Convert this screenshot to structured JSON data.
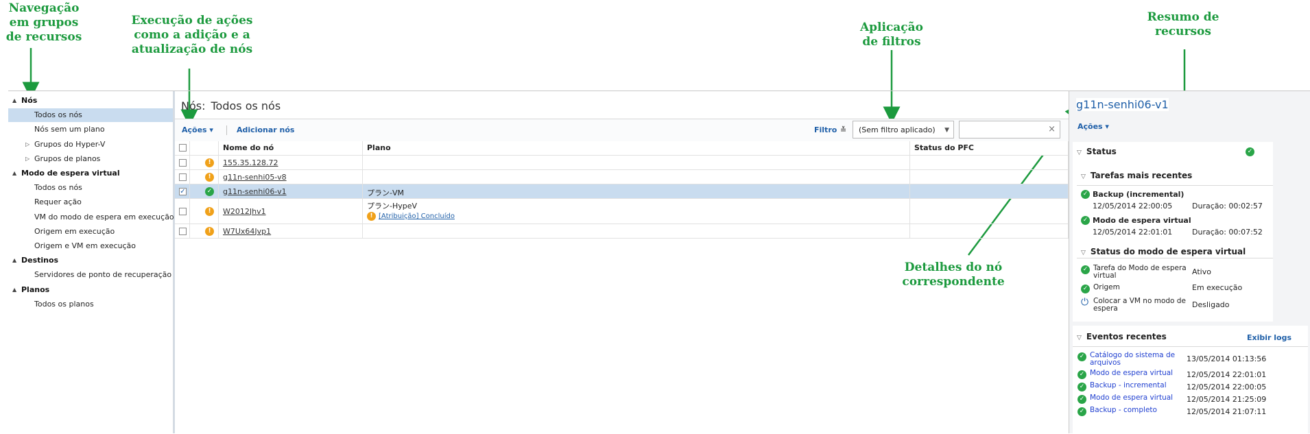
{
  "callouts": {
    "nav": [
      "Navegação",
      "em grupos",
      "de recursos"
    ],
    "actions": [
      "Execução de ações",
      "como a adição e a",
      "atualização de nós"
    ],
    "filters": [
      "Aplicação",
      "de filtros"
    ],
    "summary": [
      "Resumo de",
      "recursos"
    ],
    "details": [
      "Detalhes do nó",
      "correspondente"
    ]
  },
  "tree": [
    {
      "label": "Nós",
      "level": 0,
      "expand": "▲"
    },
    {
      "label": "Todos os nós",
      "level": 1,
      "selected": true
    },
    {
      "label": "Nós sem um plano",
      "level": 1
    },
    {
      "label": "Grupos do Hyper-V",
      "level": 1,
      "expand": "▷"
    },
    {
      "label": "Grupos de planos",
      "level": 1,
      "expand": "▷"
    },
    {
      "label": "Modo de espera virtual",
      "level": 0,
      "expand": "▲"
    },
    {
      "label": "Todos os nós",
      "level": 1
    },
    {
      "label": "Requer ação",
      "level": 1
    },
    {
      "label": "VM do modo de espera em execução",
      "level": 1
    },
    {
      "label": "Origem em execução",
      "level": 1
    },
    {
      "label": "Origem e VM em execução",
      "level": 1
    },
    {
      "label": "Destinos",
      "level": 0,
      "expand": "▲"
    },
    {
      "label": "Servidores de ponto de recuperação",
      "level": 1
    },
    {
      "label": "Planos",
      "level": 0,
      "expand": "▲"
    },
    {
      "label": "Todos os planos",
      "level": 1
    }
  ],
  "center": {
    "title_prefix": "Nós:",
    "title_value": "Todos os nós",
    "actions_label": "Ações ▾",
    "add_nodes_label": "Adicionar nós",
    "filter_label": "Filtro",
    "filter_toggle": "≚",
    "filter_value": "(Sem filtro aplicado)",
    "filter_clear": "×",
    "columns": [
      "Nome do nó",
      "Plano",
      "Status do PFC"
    ],
    "rows": [
      {
        "status": "warn",
        "name": "155.35.128.72",
        "plan": "",
        "checked": false
      },
      {
        "status": "warn",
        "name": "g11n-senhi05-v8",
        "plan": "",
        "checked": false
      },
      {
        "status": "ok",
        "name": "g11n-senhi06-v1",
        "plan": "プラン-VM",
        "checked": true,
        "selected": true
      },
      {
        "status": "warn",
        "name": "W2012Jhv1",
        "plan": "プラン-HypeV",
        "sub": "[Atribuição] Concluído",
        "checked": false
      },
      {
        "status": "warn",
        "name": "W7Ux64Jvp1",
        "plan": "",
        "checked": false
      }
    ]
  },
  "right": {
    "title": "g11n-senhi06-v1",
    "actions_label": "Ações ▾",
    "status_header": "Status",
    "recent_tasks_header": "Tarefas mais recentes",
    "tasks": [
      {
        "name": "Backup (incremental)",
        "date": "12/05/2014 22:00:05",
        "duration": "Duração: 00:02:57"
      },
      {
        "name": "Modo de espera virtual",
        "date": "12/05/2014 22:01:01",
        "duration": "Duração: 00:07:52"
      }
    ],
    "vs_header": "Status do modo de espera virtual",
    "vs_rows": [
      {
        "icon": "ok",
        "label": [
          "Tarefa do Modo de espera",
          "virtual"
        ],
        "value": "Ativo"
      },
      {
        "icon": "ok",
        "label": [
          "Origem"
        ],
        "value": "Em execução"
      },
      {
        "icon": "power",
        "label": [
          "Colocar a VM no modo de",
          "espera"
        ],
        "value": "Desligado"
      }
    ],
    "events_header": "Eventos recentes",
    "view_logs": "Exibir logs",
    "events": [
      {
        "label": [
          "Catálogo do sistema de",
          "arquivos"
        ],
        "time": "13/05/2014 01:13:56"
      },
      {
        "label": [
          "Modo de espera virtual"
        ],
        "time": "12/05/2014 22:01:01"
      },
      {
        "label": [
          "Backup - incremental"
        ],
        "time": "12/05/2014 22:00:05"
      },
      {
        "label": [
          "Modo de espera virtual"
        ],
        "time": "12/05/2014 21:25:09"
      },
      {
        "label": [
          "Backup - completo"
        ],
        "time": "12/05/2014 21:07:11"
      }
    ]
  },
  "colors": {
    "accent": "#1f5fa8",
    "callout": "#1c9a3e",
    "warn": "#f0a11a",
    "ok": "#2aa548",
    "selected": "#c9dcef"
  }
}
